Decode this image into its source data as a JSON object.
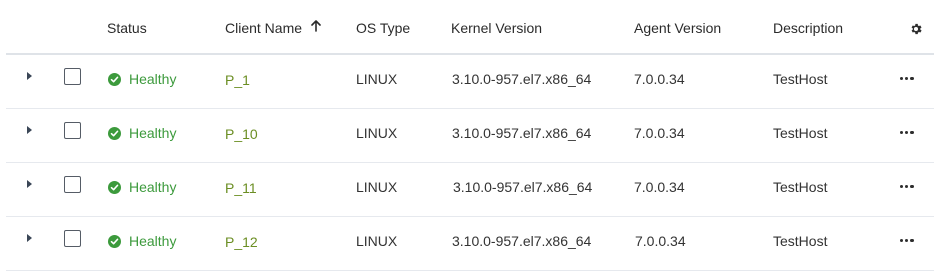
{
  "columns": {
    "status": "Status",
    "client_name": "Client Name",
    "os_type": "OS Type",
    "kernel_version": "Kernel Version",
    "agent_version": "Agent Version",
    "description": "Description"
  },
  "sort": {
    "column": "client_name",
    "direction": "ascending",
    "icon": "arrow-up-icon"
  },
  "icons": {
    "settings": "gear-icon",
    "row_actions": "more-horizontal-icon",
    "expand": "caret-right-icon",
    "status": "check-circle-icon"
  },
  "colors": {
    "healthy": "#3c9a3c",
    "client_link": "#6b8e23"
  },
  "rows": [
    {
      "status": "Healthy",
      "client_name": "P_1",
      "os_type": "LINUX",
      "kernel_version": "3.10.0-957.el7.x86_64",
      "agent_version": "7.0.0.34",
      "description": "TestHost"
    },
    {
      "status": "Healthy",
      "client_name": "P_10",
      "os_type": "LINUX",
      "kernel_version": "3.10.0-957.el7.x86_64",
      "agent_version": "7.0.0.34",
      "description": "TestHost"
    },
    {
      "status": "Healthy",
      "client_name": "P_11",
      "os_type": "LINUX",
      "kernel_version": "3.10.0-957.el7.x86_64",
      "agent_version": "7.0.0.34",
      "description": "TestHost"
    },
    {
      "status": "Healthy",
      "client_name": "P_12",
      "os_type": "LINUX",
      "kernel_version": "3.10.0-957.el7.x86_64",
      "agent_version": "7.0.0.34",
      "description": "TestHost"
    }
  ]
}
